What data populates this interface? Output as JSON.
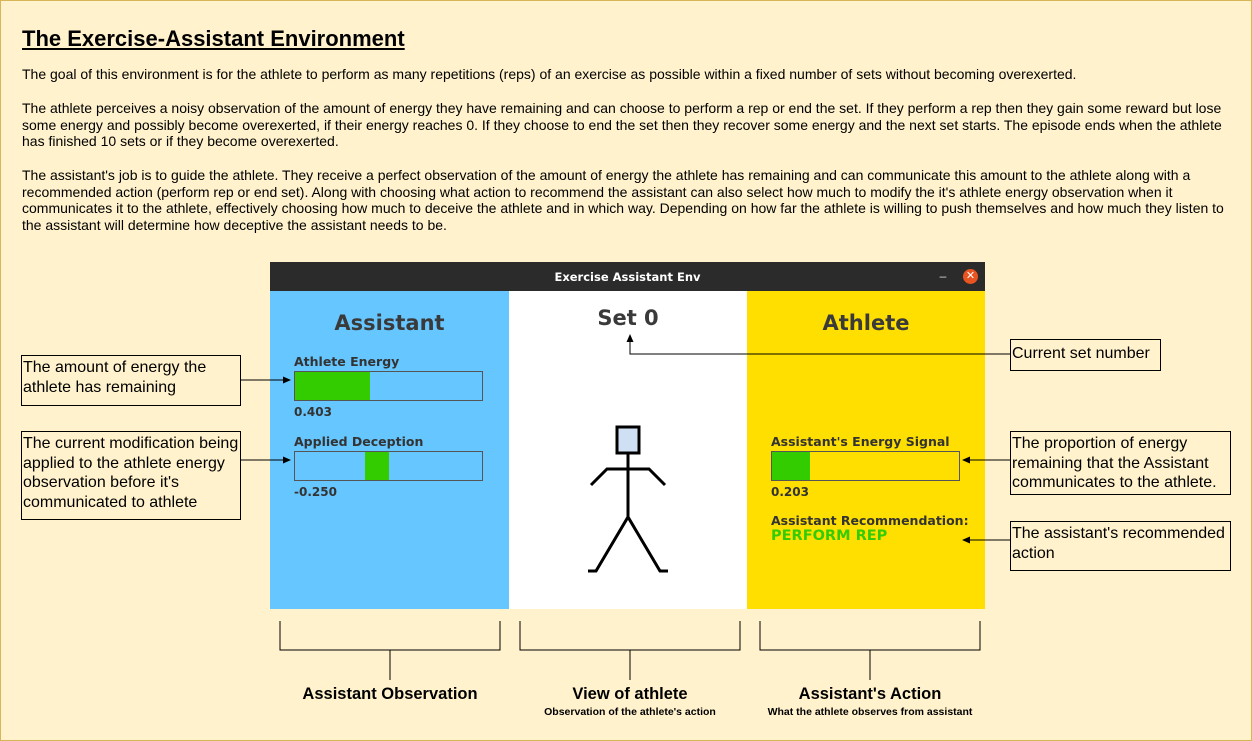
{
  "document": {
    "title": "The Exercise-Assistant Environment",
    "paragraphs": [
      "The goal of this environment is for the athlete to perform as many repetitions (reps) of an exercise as possible within a fixed number of sets without becoming overexerted.",
      "The athlete perceives a noisy observation of the amount of energy they have remaining and can choose to perform a rep or end the set. If they perform a rep then they gain some reward but lose some energy and possibly become overexerted, if their energy reaches 0. If they choose to end the set then they recover some energy and the next set starts. The episode ends when the athlete has finished 10 sets or if they become overexerted.",
      "The assistant's job is to guide the athlete. They receive a perfect observation of the amount of energy the athlete has remaining and can communicate this amount to the athlete along with a recommended action (perform rep or end set). Along with choosing what action to recommend the assistant can also select how much to modify the it's athlete energy observation when it communicates it to the athlete, effectively choosing how much to deceive the athlete and in which way. Depending on how far the athlete is willing to push themselves and how much they listen to the assistant will determine how deceptive the assistant needs to be."
    ]
  },
  "window": {
    "title": "Exercise Assistant Env",
    "minimize_symbol": "–",
    "close_symbol": "✕"
  },
  "assistant_panel": {
    "heading": "Assistant",
    "athlete_energy": {
      "label": "Athlete Energy",
      "value_text": "0.403",
      "fill_fraction": 0.403
    },
    "applied_deception": {
      "label": "Applied Deception",
      "value_text": "-0.250",
      "value": -0.25,
      "range": [
        -1,
        1
      ]
    }
  },
  "view_panel": {
    "heading": "Set 0"
  },
  "athlete_panel": {
    "heading": "Athlete",
    "energy_signal": {
      "label": "Assistant's Energy Signal",
      "value_text": "0.203",
      "fill_fraction": 0.203
    },
    "recommendation": {
      "label": "Assistant Recommendation:",
      "value": "PERFORM REP"
    }
  },
  "callouts": {
    "energy": "The amount of energy the athlete has remaining",
    "modification": "The current modification being applied to the athlete energy observation before it's communicated to athlete",
    "set_number": "Current set number",
    "proportion": "The proportion of energy remaining that the Assistant communicates to the athlete.",
    "recommended_action": "The assistant's recommended action"
  },
  "sections": {
    "observation": {
      "title": "Assistant Observation"
    },
    "view": {
      "title": "View of athlete",
      "subtitle": "Observation of the athlete's action"
    },
    "action": {
      "title": "Assistant's Action",
      "subtitle": "What the athlete observes from assistant"
    }
  },
  "colors": {
    "page_background": "#fff2cc",
    "assistant_panel": "#66c6ff",
    "view_panel": "#ffffff",
    "athlete_panel": "#ffdf00",
    "gauge_fill": "#33cc00",
    "recommendation_text": "#33cc00",
    "titlebar": "#2b2b2b",
    "close_button": "#e95420",
    "figure_head": "#cfe0f5"
  },
  "icons": {
    "athlete_figure": "stick-figure-icon"
  }
}
